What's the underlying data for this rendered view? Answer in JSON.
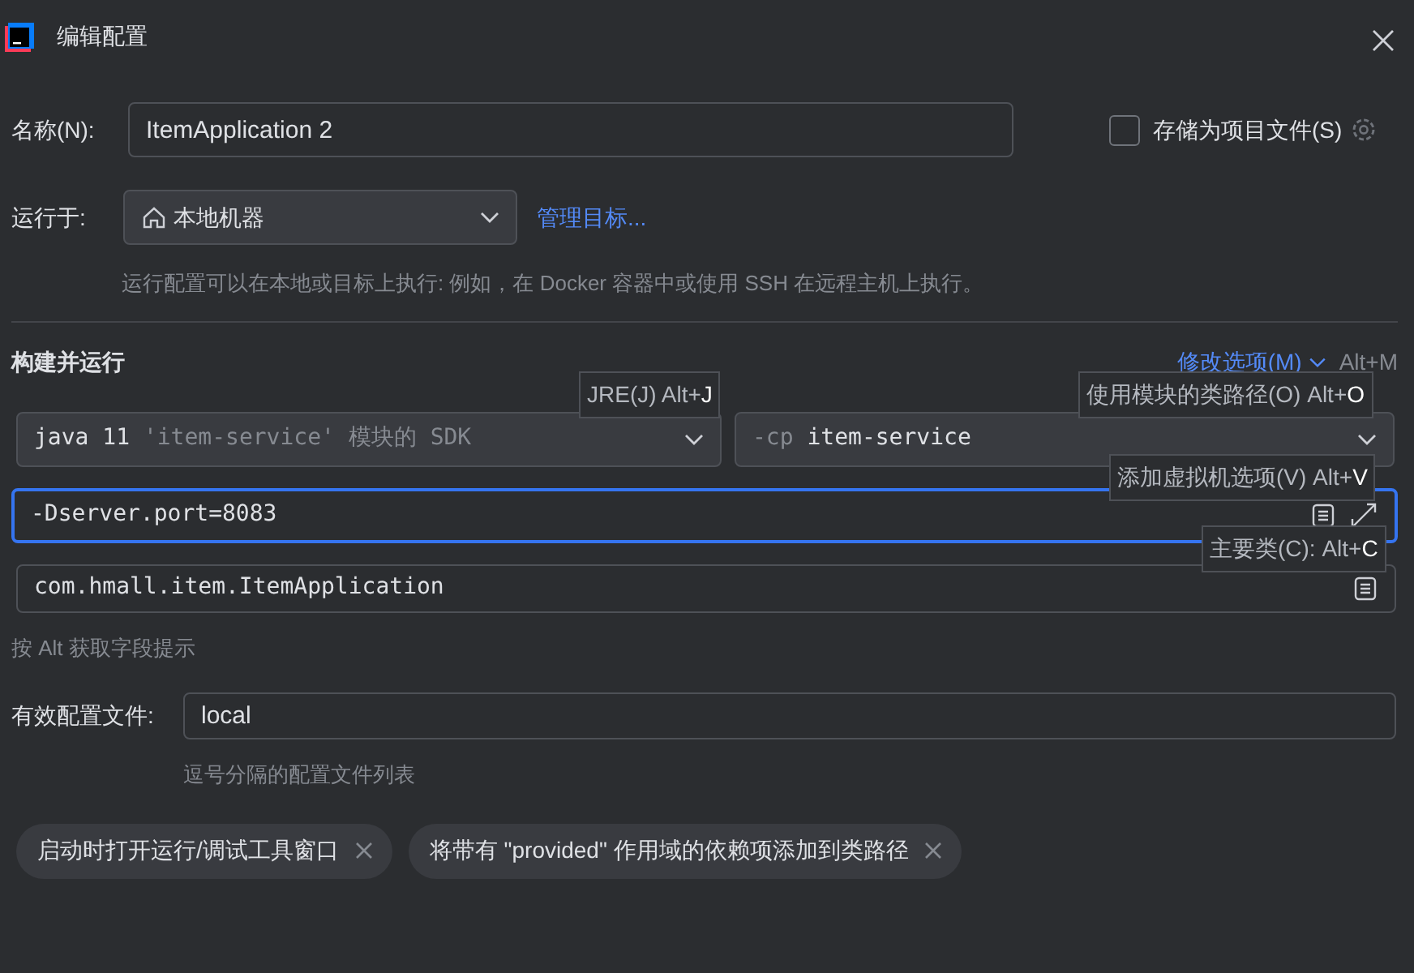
{
  "window": {
    "title": "编辑配置"
  },
  "name_field": {
    "label": "名称(N):",
    "value": "ItemApplication 2"
  },
  "store_as_file": {
    "label": "存储为项目文件(S)",
    "checked": false
  },
  "run_on": {
    "label": "运行于:",
    "value": "本地机器",
    "link": "管理目标...",
    "hint": "运行配置可以在本地或目标上执行: 例如，在 Docker 容器中或使用 SSH 在远程主机上执行。"
  },
  "section": {
    "title": "构建并运行",
    "modify_options": "修改选项(M)",
    "shortcut": "Alt+M"
  },
  "sdk_select": {
    "parts": [
      {
        "text": "java 11",
        "dim": false
      },
      {
        "text": "'item-service' 模块的 SDK",
        "dim": true
      }
    ]
  },
  "classpath_select": {
    "parts": [
      {
        "text": "-cp",
        "dim": true
      },
      {
        "text": "item-service",
        "dim": false
      }
    ]
  },
  "vm_options": {
    "value": "-Dserver.port=8083",
    "focused": true
  },
  "main_class": {
    "value": "com.hmall.item.ItemApplication",
    "focused": false
  },
  "field_hint": "按 Alt 获取字段提示",
  "profiles": {
    "label": "有效配置文件:",
    "value": "local",
    "hint": "逗号分隔的配置文件列表"
  },
  "tags": [
    {
      "label": "启动时打开运行/调试工具窗口"
    },
    {
      "label": "将带有 \"provided\" 作用域的依赖项添加到类路径"
    }
  ],
  "tooltips": [
    {
      "text": "JRE(J) Alt+",
      "key": "J"
    },
    {
      "text": "使用模块的类路径(O) Alt+",
      "key": "O"
    },
    {
      "text": "添加虚拟机选项(V) Alt+",
      "key": "V"
    },
    {
      "text": "主要类(C): Alt+",
      "key": "C"
    }
  ]
}
